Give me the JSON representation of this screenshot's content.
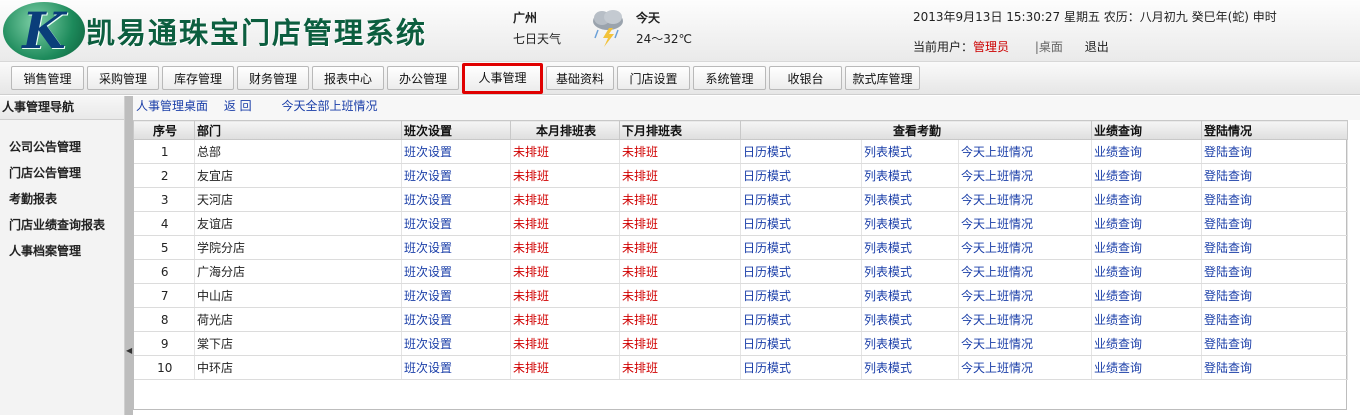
{
  "header": {
    "logo_letter": "K",
    "system_name": "凯易通珠宝门店管理系统",
    "city": "广州",
    "weather_caption": "七日天气",
    "weather_day": "今天",
    "weather_temp": "24～32℃",
    "datetime": "2013年9月13日 15:30:27 星期五 农历：八月初九 癸巳年(蛇) 申时",
    "user_label": "当前用户：",
    "user_name": "管理员",
    "desktop_link": "|桌面",
    "logout_link": "退出"
  },
  "nav": {
    "items": [
      {
        "label": "销售管理"
      },
      {
        "label": "采购管理"
      },
      {
        "label": "库存管理"
      },
      {
        "label": "财务管理"
      },
      {
        "label": "报表中心"
      },
      {
        "label": "办公管理"
      },
      {
        "label": "人事管理"
      },
      {
        "label": "基础资料"
      },
      {
        "label": "门店设置"
      },
      {
        "label": "系统管理"
      },
      {
        "label": "收银台"
      },
      {
        "label": "款式库管理"
      }
    ],
    "active": "人事管理"
  },
  "sidebar": {
    "title": "人事管理导航",
    "items": [
      {
        "label": "公司公告管理"
      },
      {
        "label": "门店公告管理"
      },
      {
        "label": "考勤报表"
      },
      {
        "label": "门店业绩查询报表"
      },
      {
        "label": "人事档案管理"
      }
    ]
  },
  "toolbar": {
    "home": "人事管理桌面",
    "back": "返 回",
    "today_all": "今天全部上班情况"
  },
  "table": {
    "headers": {
      "seq": "序号",
      "dept": "部门",
      "shift": "班次设置",
      "this_month": "本月排班表",
      "next_month": "下月排班表",
      "attendance": "查看考勤",
      "performance": "业绩查询",
      "login": "登陆情况"
    },
    "cell_labels": {
      "shift": "班次设置",
      "unscheduled": "未排班",
      "calendar": "日历模式",
      "list": "列表模式",
      "today": "今天上班情况",
      "performance": "业绩查询",
      "login": "登陆查询"
    },
    "rows": [
      {
        "seq": "1",
        "dept": "总部"
      },
      {
        "seq": "2",
        "dept": "友宜店"
      },
      {
        "seq": "3",
        "dept": "天河店"
      },
      {
        "seq": "4",
        "dept": "友谊店"
      },
      {
        "seq": "5",
        "dept": "学院分店"
      },
      {
        "seq": "6",
        "dept": "广海分店"
      },
      {
        "seq": "7",
        "dept": "中山店"
      },
      {
        "seq": "8",
        "dept": "荷光店"
      },
      {
        "seq": "9",
        "dept": "棠下店"
      },
      {
        "seq": "10",
        "dept": "中环店"
      }
    ]
  },
  "colors": {
    "link": "#1a3ea8",
    "unscheduled": "#d00000",
    "active_nav_border": "#e00000",
    "logo_green": "#0c5e3f"
  }
}
